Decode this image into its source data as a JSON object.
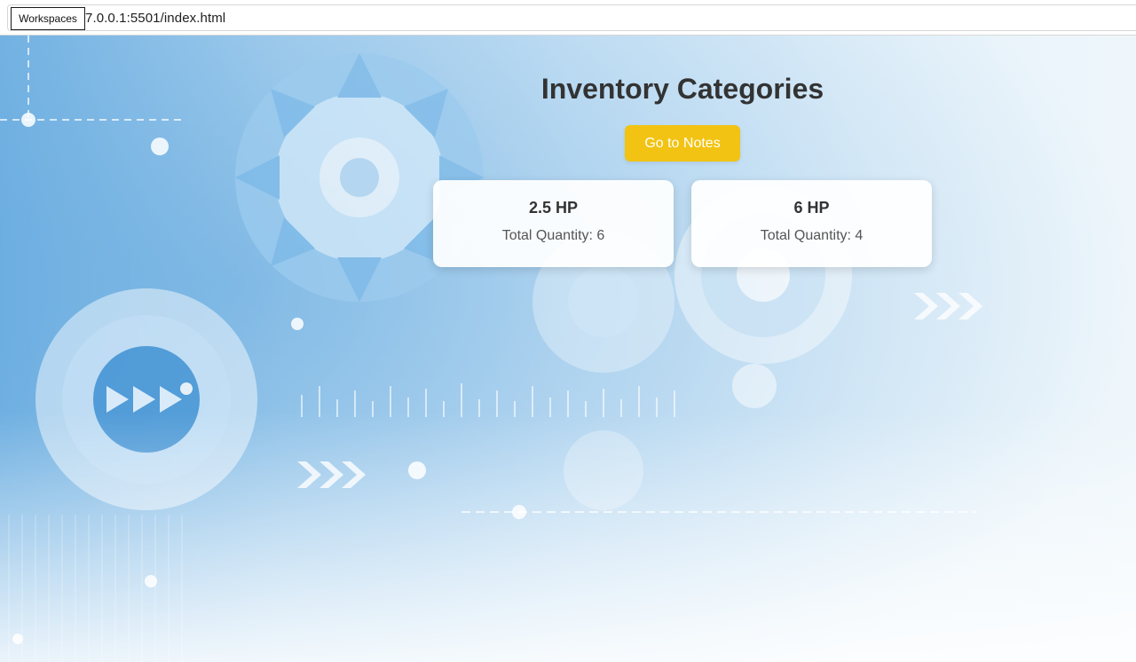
{
  "browser": {
    "url_text": "7.0.0.1:5501/index.html",
    "tooltip": "Workspaces"
  },
  "page": {
    "title": "Inventory Categories",
    "notes_button": "Go to Notes",
    "button_color": "#f2c312",
    "categories": [
      {
        "name": "2.5 HP",
        "quantity_text": "Total Quantity: 6"
      },
      {
        "name": "6 HP",
        "quantity_text": "Total Quantity: 4"
      }
    ]
  }
}
